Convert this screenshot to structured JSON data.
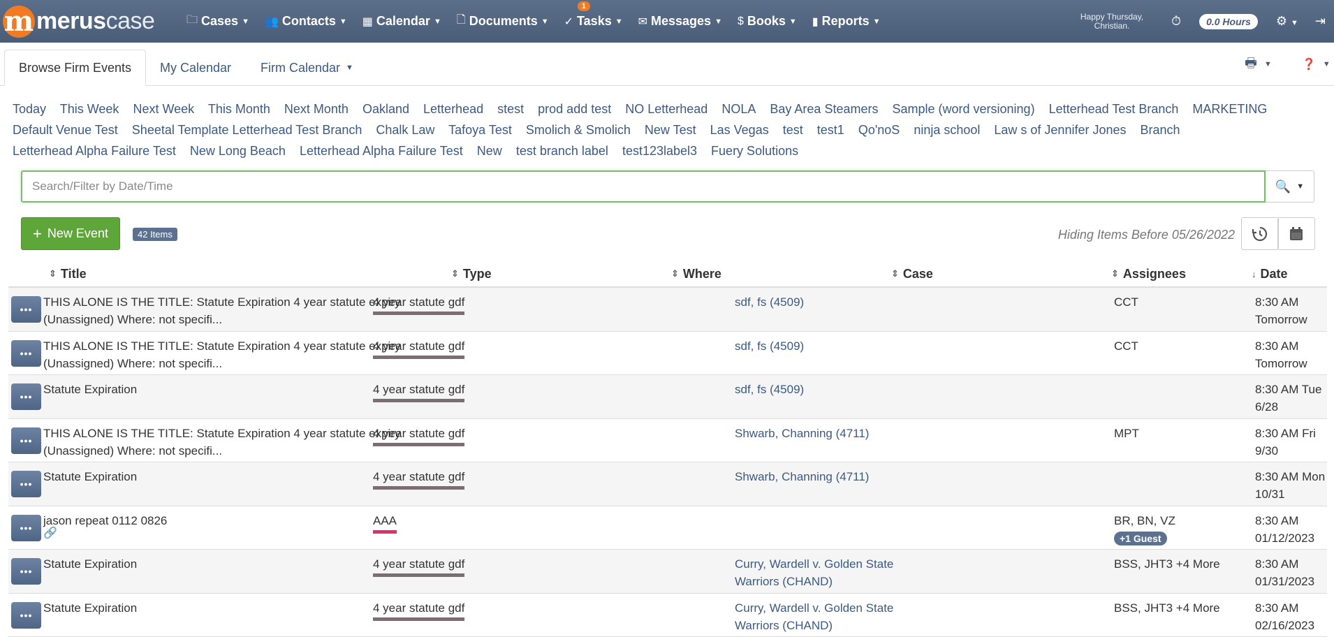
{
  "brand": {
    "mark": "m",
    "name_bold": "merus",
    "name_thin": "case"
  },
  "nav": {
    "items": [
      {
        "icon": "folder-icon",
        "glyph": "🗀",
        "label": "Cases"
      },
      {
        "icon": "contacts-icon",
        "glyph": "👥",
        "label": "Contacts"
      },
      {
        "icon": "calendar-icon",
        "glyph": "▦",
        "label": "Calendar"
      },
      {
        "icon": "document-icon",
        "glyph": "🗋",
        "label": "Documents"
      },
      {
        "icon": "tasks-icon",
        "glyph": "✓",
        "label": "Tasks",
        "badge": "1"
      },
      {
        "icon": "envelope-icon",
        "glyph": "✉",
        "label": "Messages"
      },
      {
        "icon": "dollar-icon",
        "glyph": "$",
        "label": "Books"
      },
      {
        "icon": "chart-icon",
        "glyph": "▮",
        "label": "Reports"
      }
    ],
    "greeting": "Happy Thursday, Christian.",
    "hours": "0.0 Hours"
  },
  "tabs": {
    "browse": "Browse Firm Events",
    "my_calendar": "My Calendar",
    "firm_calendar": "Firm Calendar"
  },
  "filters": [
    "Today",
    "This Week",
    "Next Week",
    "This Month",
    "Next Month",
    "Oakland",
    "Letterhead",
    "stest",
    "prod add test",
    "NO Letterhead",
    "NOLA",
    "Bay Area Steamers",
    "Sample (word versioning)",
    "Letterhead Test Branch",
    "MARKETING",
    "Default Venue Test",
    "Sheetal Template Letterhead Test Branch",
    "Chalk Law",
    "Tafoya Test",
    "Smolich & Smolich",
    "New Test",
    "Las Vegas",
    "test",
    "test1",
    "Qo'noS",
    "ninja school",
    "Law s of Jennifer Jones",
    "Branch",
    "Letterhead Alpha Failure Test",
    "New Long Beach",
    "Letterhead Alpha Failure Test",
    "New",
    "test branch label",
    "test123label3",
    "Fuery Solutions"
  ],
  "search": {
    "placeholder": "Search/Filter by Date/Time",
    "value": ""
  },
  "actions": {
    "new_event": "New Event",
    "items_count": "42 Items",
    "hiding_text": "Hiding Items Before 05/26/2022"
  },
  "table": {
    "columns": {
      "title": "Title",
      "type": "Type",
      "where": "Where",
      "case": "Case",
      "assignees": "Assignees",
      "date": "Date"
    },
    "rows": [
      {
        "title": "THIS ALONE IS THE TITLE: Statute Expiration 4 year statute expiry (Unassigned) Where: not specifi...",
        "type": "4 year statute gdf",
        "type_color": "#7a6e72",
        "where": "",
        "case": "sdf, fs (4509)",
        "assignees": "CCT",
        "guest": "",
        "date": "8:30 AM Tomorrow"
      },
      {
        "title": "THIS ALONE IS THE TITLE: Statute Expiration 4 year statute expiry (Unassigned) Where: not specifi...",
        "type": "4 year statute gdf",
        "type_color": "#7a6e72",
        "where": "",
        "case": "sdf, fs (4509)",
        "assignees": "CCT",
        "guest": "",
        "date": "8:30 AM Tomorrow"
      },
      {
        "title": "Statute Expiration",
        "type": "4 year statute gdf",
        "type_color": "#7a6e72",
        "where": "",
        "case": "sdf, fs (4509)",
        "assignees": "",
        "guest": "",
        "date": "8:30 AM Tue 6/28"
      },
      {
        "title": "THIS ALONE IS THE TITLE: Statute Expiration 4 year statute expiry (Unassigned) Where: not specifi...",
        "type": "4 year statute gdf",
        "type_color": "#7a6e72",
        "where": "",
        "case": "Shwarb, Channing (4711)",
        "assignees": "MPT",
        "guest": "",
        "date": "8:30 AM Fri 9/30"
      },
      {
        "title": "Statute Expiration",
        "type": "4 year statute gdf",
        "type_color": "#7a6e72",
        "where": "",
        "case": "Shwarb, Channing (4711)",
        "assignees": "",
        "guest": "",
        "date": "8:30 AM Mon 10/31"
      },
      {
        "title": "jason repeat 0112 0826",
        "type": "AAA",
        "type_color": "#e0306a",
        "where": "",
        "case": "",
        "assignees": "BR, BN, VZ",
        "guest": "+1 Guest",
        "date": "8:30 AM 01/12/2023",
        "linked": true
      },
      {
        "title": "Statute Expiration",
        "type": "4 year statute gdf",
        "type_color": "#7a6e72",
        "where": "",
        "case": "Curry, Wardell v. Golden State Warriors (CHAND)",
        "assignees": "BSS, JHT3 +4 More",
        "guest": "",
        "date": "8:30 AM 01/31/2023"
      },
      {
        "title": "Statute Expiration",
        "type": "4 year statute gdf",
        "type_color": "#7a6e72",
        "where": "",
        "case": "Curry, Wardell v. Golden State Warriors (CHAND)",
        "assignees": "BSS, JHT3 +4 More",
        "guest": "",
        "date": "8:30 AM 02/16/2023"
      }
    ],
    "more_label": "•••"
  }
}
